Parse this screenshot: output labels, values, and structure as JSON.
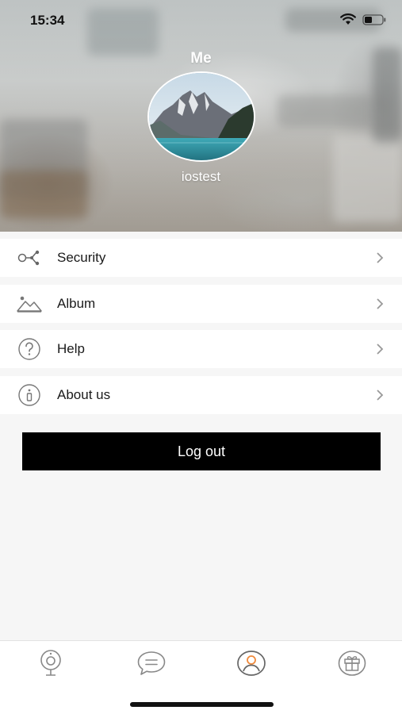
{
  "status_bar": {
    "time": "15:34",
    "icons": [
      "wifi-icon",
      "battery-icon"
    ]
  },
  "header": {
    "title": "Me",
    "username": "iostest",
    "avatar": "mountain-lake-photo"
  },
  "menu": {
    "items": [
      {
        "label": "Security",
        "icon": "share-nodes-icon"
      },
      {
        "label": "Album",
        "icon": "mountain-image-icon"
      },
      {
        "label": "Help",
        "icon": "question-circle-icon"
      },
      {
        "label": "About us",
        "icon": "info-circle-icon"
      }
    ]
  },
  "logout": {
    "label": "Log out"
  },
  "tabbar": {
    "tabs": [
      {
        "icon": "camera-icon",
        "active": false
      },
      {
        "icon": "message-icon",
        "active": false
      },
      {
        "icon": "user-icon",
        "active": true
      },
      {
        "icon": "gift-icon",
        "active": false
      }
    ],
    "active_color": "#f08a3c",
    "inactive_color": "#888888"
  },
  "colors": {
    "logout_bg": "#000000",
    "page_bg": "#f6f6f6"
  }
}
